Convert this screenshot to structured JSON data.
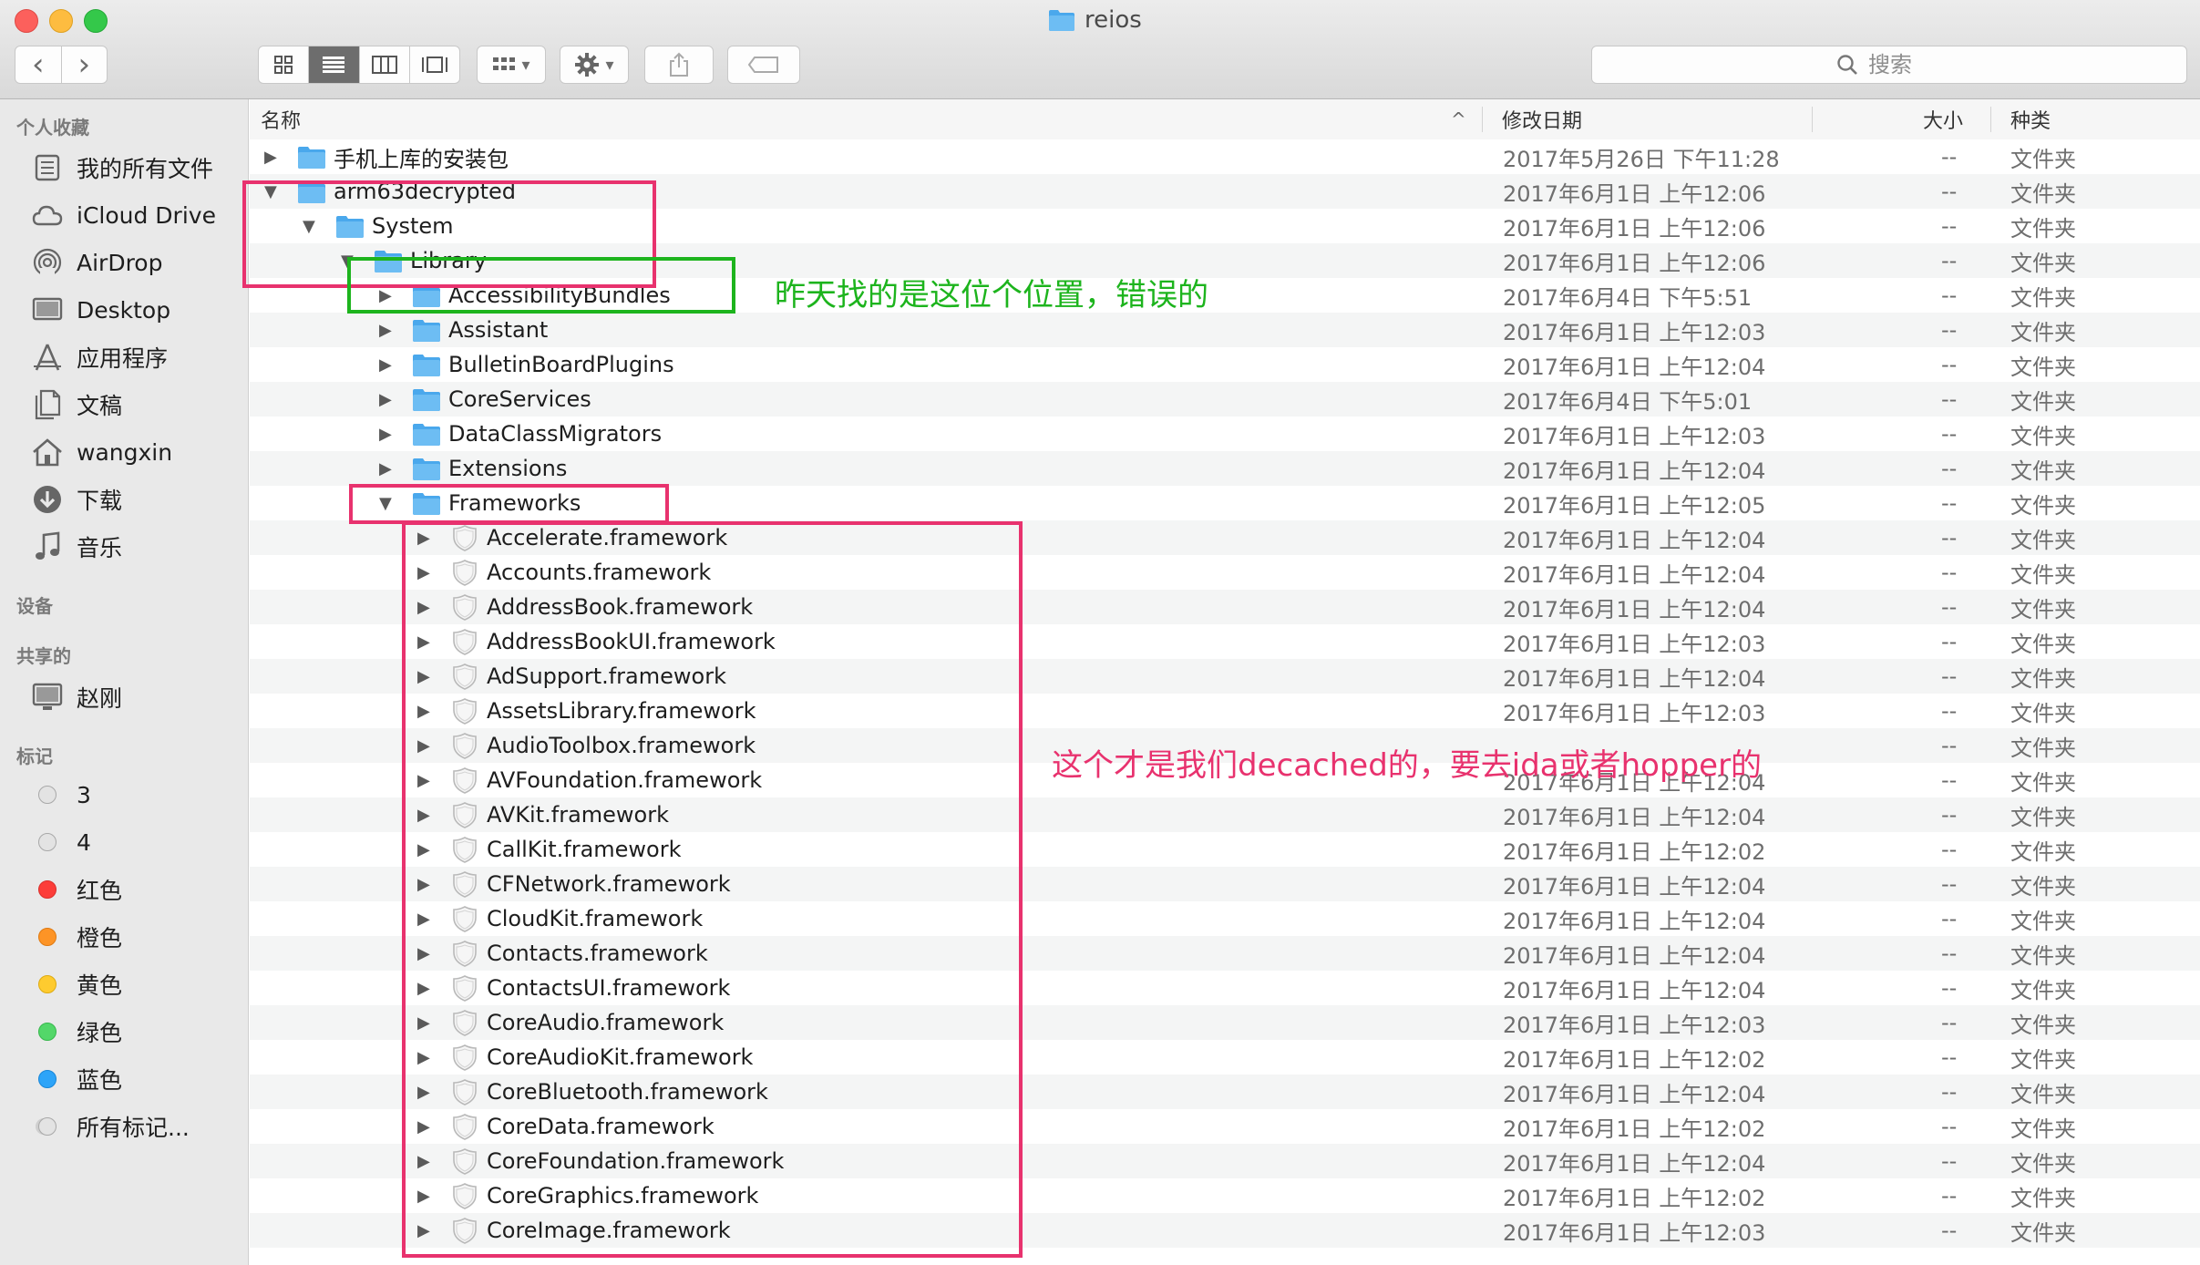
{
  "window": {
    "title": "reios"
  },
  "toolbar": {
    "back_glyph": "‹",
    "forward_glyph": "›",
    "arrange_glyph": "▾",
    "action_glyph": "▾",
    "search_placeholder": "搜索"
  },
  "sidebar": {
    "favorites_heading": "个人收藏",
    "favorites": [
      {
        "label": "我的所有文件",
        "icon": "all-files-icon"
      },
      {
        "label": "iCloud Drive",
        "icon": "cloud-icon"
      },
      {
        "label": "AirDrop",
        "icon": "airdrop-icon"
      },
      {
        "label": "Desktop",
        "icon": "desktop-icon"
      },
      {
        "label": "应用程序",
        "icon": "applications-icon"
      },
      {
        "label": "文稿",
        "icon": "documents-icon"
      },
      {
        "label": "wangxin",
        "icon": "home-icon"
      },
      {
        "label": "下载",
        "icon": "downloads-icon"
      },
      {
        "label": "音乐",
        "icon": "music-icon"
      }
    ],
    "devices_heading": "设备",
    "shared_heading": "共享的",
    "shared": [
      {
        "label": "赵刚",
        "icon": "computer-icon"
      }
    ],
    "tags_heading": "标记",
    "tags": [
      {
        "label": "3",
        "color": "#e8e8e8"
      },
      {
        "label": "4",
        "color": "#e8e8e8"
      },
      {
        "label": "红色",
        "color": "#fc3d39"
      },
      {
        "label": "橙色",
        "color": "#fd9426"
      },
      {
        "label": "黄色",
        "color": "#fecb2f"
      },
      {
        "label": "绿色",
        "color": "#53d769"
      },
      {
        "label": "蓝色",
        "color": "#2da4f8"
      },
      {
        "label": "所有标记...",
        "color": "#e8e8e8"
      }
    ]
  },
  "columns": {
    "name": "名称",
    "sort_glyph": "^",
    "modified": "修改日期",
    "size": "大小",
    "kind": "种类"
  },
  "rows": [
    {
      "name": "手机上库的安装包",
      "date": "2017年5月26日 下午11:28",
      "size": "--",
      "kind": "文件夹",
      "level": 0,
      "expanded": false,
      "type": "folder"
    },
    {
      "name": "arm63decrypted",
      "date": "2017年6月1日 上午12:06",
      "size": "--",
      "kind": "文件夹",
      "level": 0,
      "expanded": true,
      "type": "folder"
    },
    {
      "name": "System",
      "date": "2017年6月1日 上午12:06",
      "size": "--",
      "kind": "文件夹",
      "level": 1,
      "expanded": true,
      "type": "folder"
    },
    {
      "name": "Library",
      "date": "2017年6月1日 上午12:06",
      "size": "--",
      "kind": "文件夹",
      "level": 2,
      "expanded": true,
      "type": "folder"
    },
    {
      "name": "AccessibilityBundles",
      "date": "2017年6月4日 下午5:51",
      "size": "--",
      "kind": "文件夹",
      "level": 3,
      "expanded": false,
      "type": "folder"
    },
    {
      "name": "Assistant",
      "date": "2017年6月1日 上午12:03",
      "size": "--",
      "kind": "文件夹",
      "level": 3,
      "expanded": false,
      "type": "folder"
    },
    {
      "name": "BulletinBoardPlugins",
      "date": "2017年6月1日 上午12:04",
      "size": "--",
      "kind": "文件夹",
      "level": 3,
      "expanded": false,
      "type": "folder"
    },
    {
      "name": "CoreServices",
      "date": "2017年6月4日 下午5:01",
      "size": "--",
      "kind": "文件夹",
      "level": 3,
      "expanded": false,
      "type": "folder"
    },
    {
      "name": "DataClassMigrators",
      "date": "2017年6月1日 上午12:03",
      "size": "--",
      "kind": "文件夹",
      "level": 3,
      "expanded": false,
      "type": "folder"
    },
    {
      "name": "Extensions",
      "date": "2017年6月1日 上午12:04",
      "size": "--",
      "kind": "文件夹",
      "level": 3,
      "expanded": false,
      "type": "folder"
    },
    {
      "name": "Frameworks",
      "date": "2017年6月1日 上午12:05",
      "size": "--",
      "kind": "文件夹",
      "level": 3,
      "expanded": true,
      "type": "folder"
    },
    {
      "name": "Accelerate.framework",
      "date": "2017年6月1日 上午12:04",
      "size": "--",
      "kind": "文件夹",
      "level": 4,
      "expanded": false,
      "type": "framework"
    },
    {
      "name": "Accounts.framework",
      "date": "2017年6月1日 上午12:04",
      "size": "--",
      "kind": "文件夹",
      "level": 4,
      "expanded": false,
      "type": "framework"
    },
    {
      "name": "AddressBook.framework",
      "date": "2017年6月1日 上午12:04",
      "size": "--",
      "kind": "文件夹",
      "level": 4,
      "expanded": false,
      "type": "framework"
    },
    {
      "name": "AddressBookUI.framework",
      "date": "2017年6月1日 上午12:03",
      "size": "--",
      "kind": "文件夹",
      "level": 4,
      "expanded": false,
      "type": "framework"
    },
    {
      "name": "AdSupport.framework",
      "date": "2017年6月1日 上午12:04",
      "size": "--",
      "kind": "文件夹",
      "level": 4,
      "expanded": false,
      "type": "framework"
    },
    {
      "name": "AssetsLibrary.framework",
      "date": "2017年6月1日 上午12:03",
      "size": "--",
      "kind": "文件夹",
      "level": 4,
      "expanded": false,
      "type": "framework"
    },
    {
      "name": "AudioToolbox.framework",
      "date": "",
      "size": "--",
      "kind": "文件夹",
      "level": 4,
      "expanded": false,
      "type": "framework"
    },
    {
      "name": "AVFoundation.framework",
      "date": "2017年6月1日 上午12:04",
      "size": "--",
      "kind": "文件夹",
      "level": 4,
      "expanded": false,
      "type": "framework"
    },
    {
      "name": "AVKit.framework",
      "date": "2017年6月1日 上午12:04",
      "size": "--",
      "kind": "文件夹",
      "level": 4,
      "expanded": false,
      "type": "framework"
    },
    {
      "name": "CallKit.framework",
      "date": "2017年6月1日 上午12:02",
      "size": "--",
      "kind": "文件夹",
      "level": 4,
      "expanded": false,
      "type": "framework"
    },
    {
      "name": "CFNetwork.framework",
      "date": "2017年6月1日 上午12:04",
      "size": "--",
      "kind": "文件夹",
      "level": 4,
      "expanded": false,
      "type": "framework"
    },
    {
      "name": "CloudKit.framework",
      "date": "2017年6月1日 上午12:04",
      "size": "--",
      "kind": "文件夹",
      "level": 4,
      "expanded": false,
      "type": "framework"
    },
    {
      "name": "Contacts.framework",
      "date": "2017年6月1日 上午12:04",
      "size": "--",
      "kind": "文件夹",
      "level": 4,
      "expanded": false,
      "type": "framework"
    },
    {
      "name": "ContactsUI.framework",
      "date": "2017年6月1日 上午12:04",
      "size": "--",
      "kind": "文件夹",
      "level": 4,
      "expanded": false,
      "type": "framework"
    },
    {
      "name": "CoreAudio.framework",
      "date": "2017年6月1日 上午12:03",
      "size": "--",
      "kind": "文件夹",
      "level": 4,
      "expanded": false,
      "type": "framework"
    },
    {
      "name": "CoreAudioKit.framework",
      "date": "2017年6月1日 上午12:02",
      "size": "--",
      "kind": "文件夹",
      "level": 4,
      "expanded": false,
      "type": "framework"
    },
    {
      "name": "CoreBluetooth.framework",
      "date": "2017年6月1日 上午12:04",
      "size": "--",
      "kind": "文件夹",
      "level": 4,
      "expanded": false,
      "type": "framework"
    },
    {
      "name": "CoreData.framework",
      "date": "2017年6月1日 上午12:02",
      "size": "--",
      "kind": "文件夹",
      "level": 4,
      "expanded": false,
      "type": "framework"
    },
    {
      "name": "CoreFoundation.framework",
      "date": "2017年6月1日 上午12:04",
      "size": "--",
      "kind": "文件夹",
      "level": 4,
      "expanded": false,
      "type": "framework"
    },
    {
      "name": "CoreGraphics.framework",
      "date": "2017年6月1日 上午12:02",
      "size": "--",
      "kind": "文件夹",
      "level": 4,
      "expanded": false,
      "type": "framework"
    },
    {
      "name": "CoreImage.framework",
      "date": "2017年6月1日 上午12:03",
      "size": "--",
      "kind": "文件夹",
      "level": 4,
      "expanded": false,
      "type": "framework"
    }
  ],
  "annotations": {
    "green_note": "昨天找的是这位个位置，错误的",
    "pink_note": "这个才是我们decached的，要去ida或者hopper的",
    "green_color": "#1db41d",
    "pink_color": "#e8326e"
  },
  "colors": {
    "folder_blue": "#4aa8ec",
    "window_bg": "#e9e9e9"
  }
}
